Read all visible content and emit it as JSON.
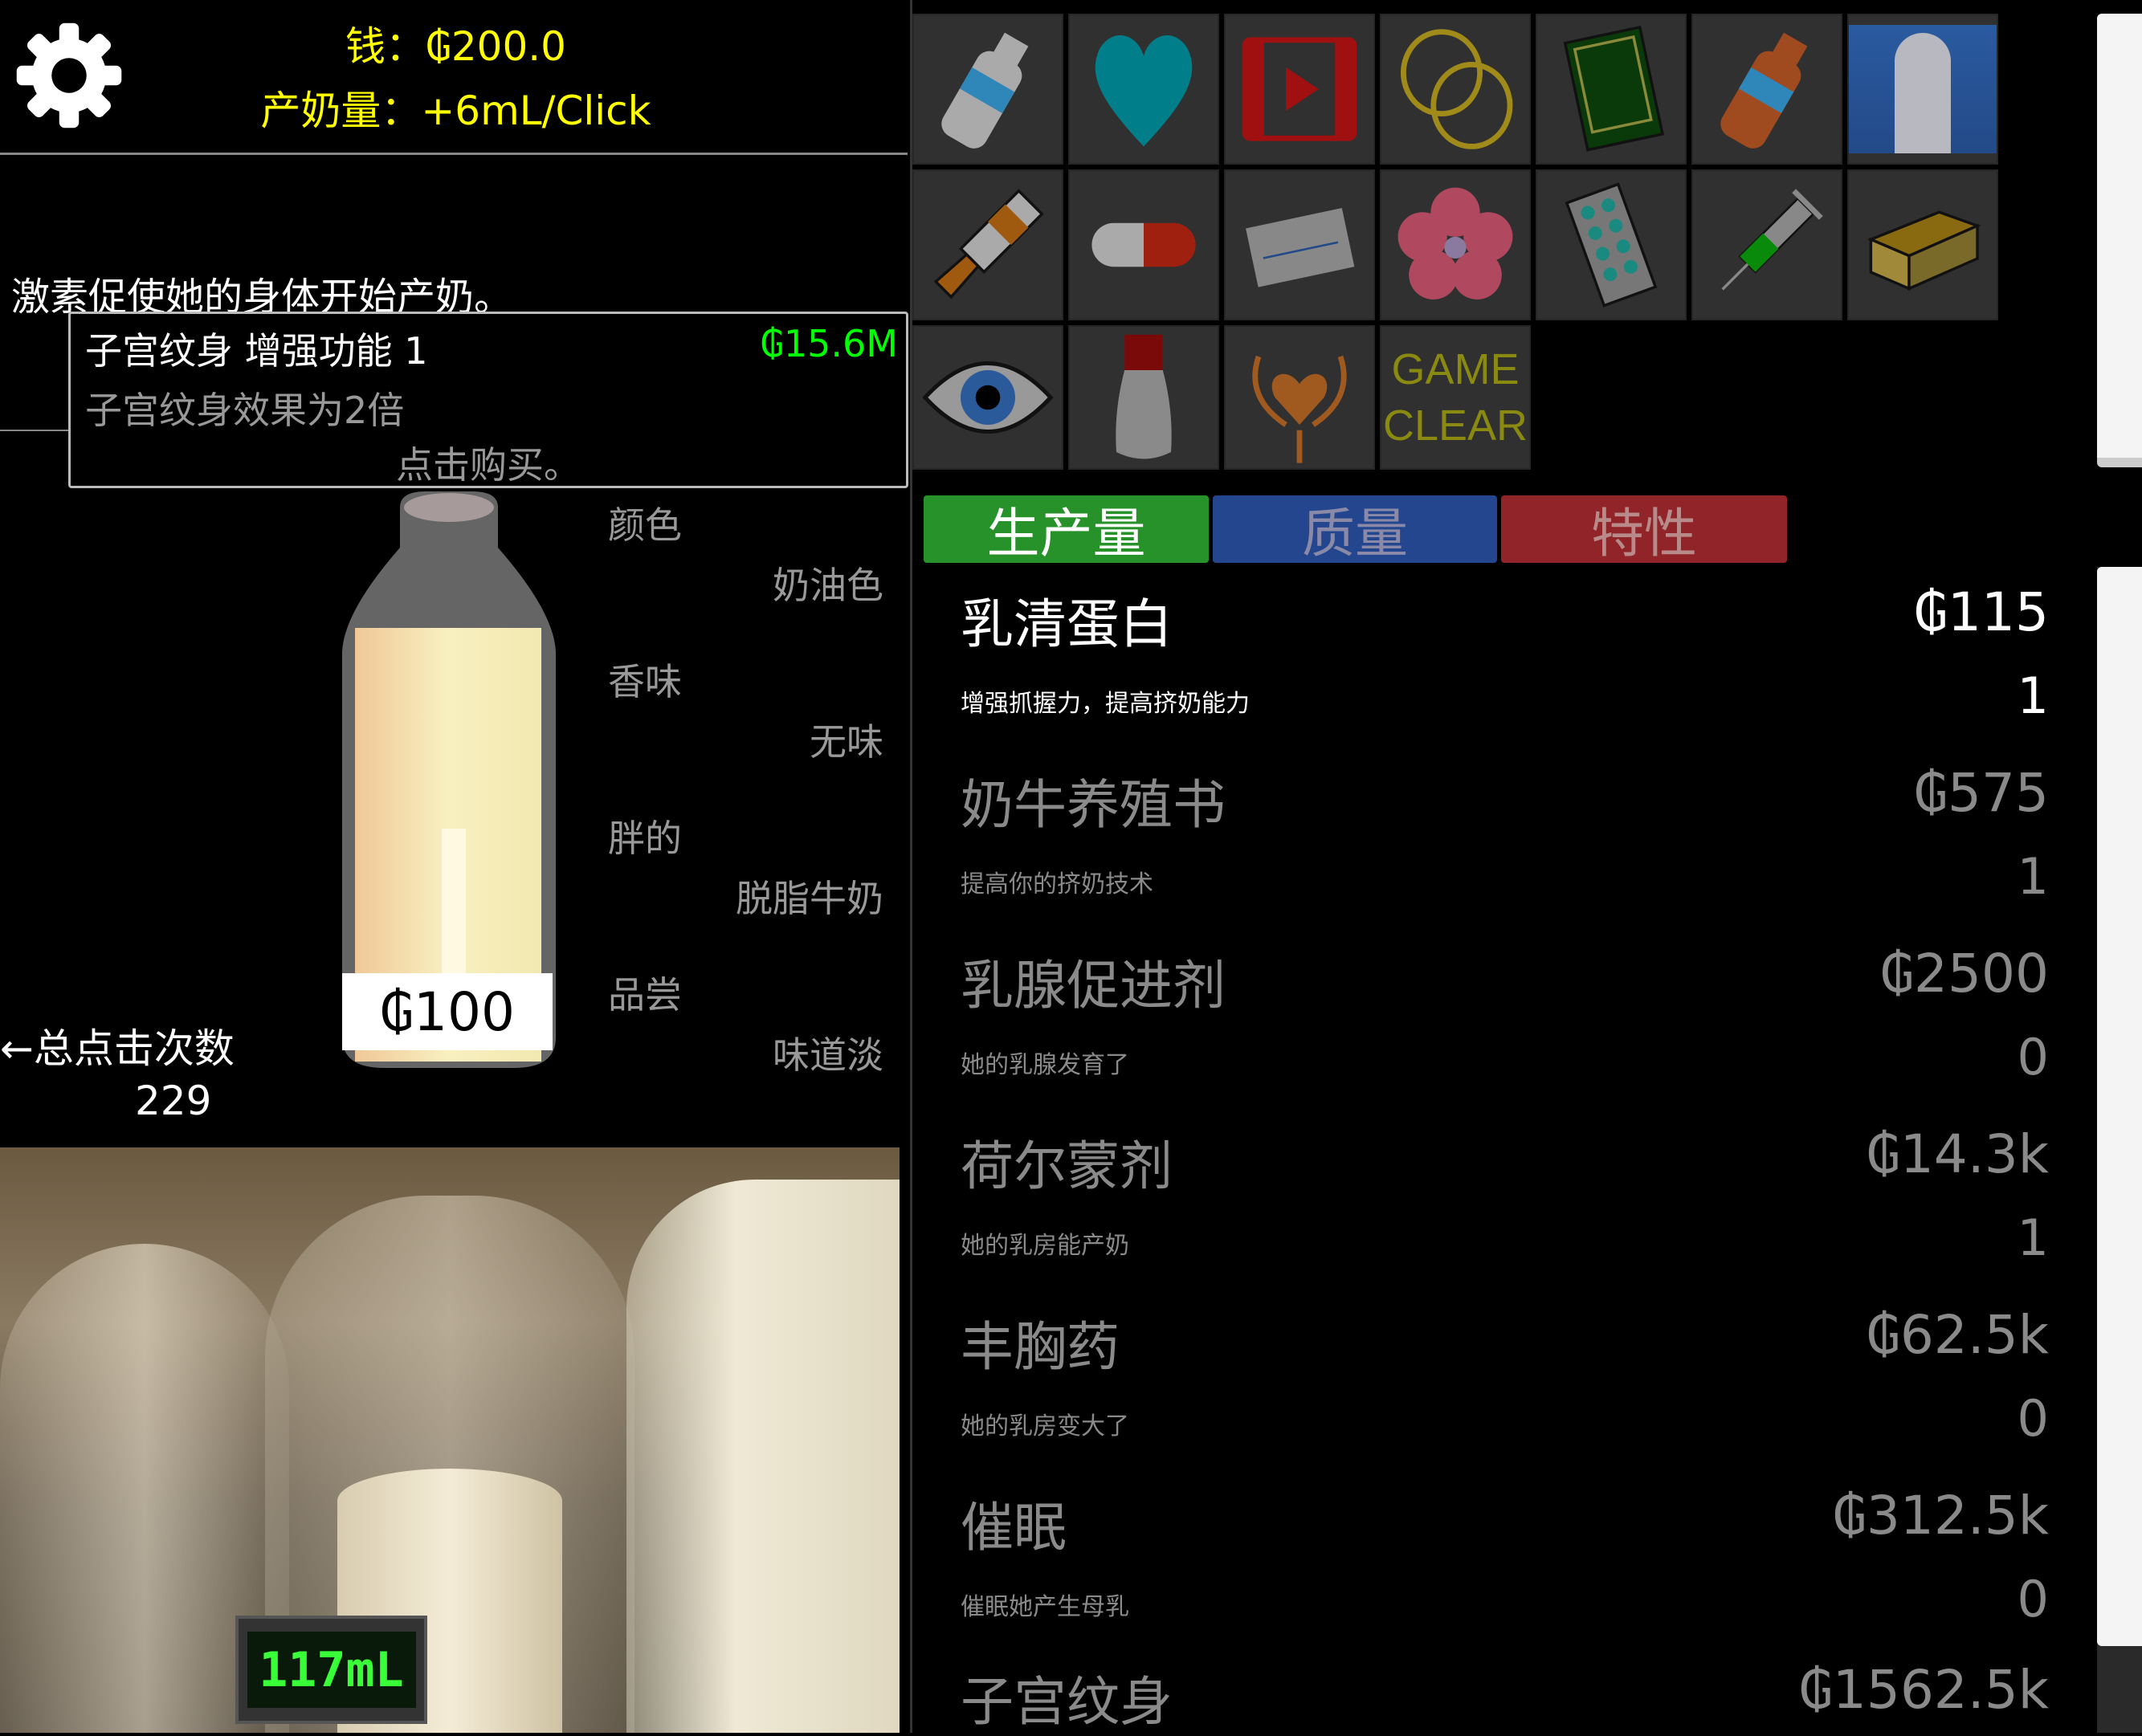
{
  "header": {
    "settings_icon": "gear-icon",
    "money_label": "钱：₲200.0",
    "production_label": "产奶量：+6mL/Click"
  },
  "message": "激素促使她的身体开始产奶。",
  "tooltip": {
    "title": "子宫纹身 增强功能 1",
    "price": "₲15.6M",
    "description": "子宫纹身效果为2倍",
    "action": "点击购买。",
    "price_color": "#00ff00"
  },
  "bottle": {
    "price_tag": "₲100",
    "attributes": [
      {
        "label": "颜色",
        "value": "奶油色"
      },
      {
        "label": "香味",
        "value": "无味"
      },
      {
        "label": "胖的",
        "value": "脱脂牛奶"
      },
      {
        "label": "品尝",
        "value": "味道淡"
      }
    ]
  },
  "clicks": {
    "label": "←总点击次数",
    "value": "229"
  },
  "scene": {
    "volume_display": "117mL"
  },
  "icon_grid": [
    "milk-bottle-icon",
    "heart-icon",
    "video-icon",
    "rings-icon",
    "book-icon",
    "chocolate-milk-icon",
    "character-portrait",
    "paint-tube-icon",
    "capsule-icon",
    "name-card-icon",
    "flower-icon",
    "pill-pack-icon",
    "syringe-icon",
    "box-icon",
    "eye-icon",
    "powder-bottle-icon",
    "womb-tattoo-icon",
    "game-clear-icon"
  ],
  "game_clear_text": [
    "GAME",
    "CLEAR"
  ],
  "tabs": [
    {
      "label": "生产量",
      "color": "#27922a",
      "active": true
    },
    {
      "label": "质量",
      "color": "#23468f",
      "active": false
    },
    {
      "label": "特性",
      "color": "#902428",
      "active": false
    }
  ],
  "upgrades": [
    {
      "name": "乳清蛋白",
      "price": "₲115",
      "description": "增强抓握力，提高挤奶能力",
      "count": "1",
      "affordable": true
    },
    {
      "name": "奶牛养殖书",
      "price": "₲575",
      "description": "提高你的挤奶技术",
      "count": "1",
      "affordable": false
    },
    {
      "name": "乳腺促进剂",
      "price": "₲2500",
      "description": "她的乳腺发育了",
      "count": "0",
      "affordable": false
    },
    {
      "name": "荷尔蒙剂",
      "price": "₲14.3k",
      "description": "她的乳房能产奶",
      "count": "1",
      "affordable": false
    },
    {
      "name": "丰胸药",
      "price": "₲62.5k",
      "description": "她的乳房变大了",
      "count": "0",
      "affordable": false
    },
    {
      "name": "催眠",
      "price": "₲312.5k",
      "description": "催眠她产生母乳",
      "count": "0",
      "affordable": false
    },
    {
      "name": "子宫纹身",
      "price": "₲1562.5k",
      "description": "",
      "count": "",
      "affordable": false
    }
  ]
}
